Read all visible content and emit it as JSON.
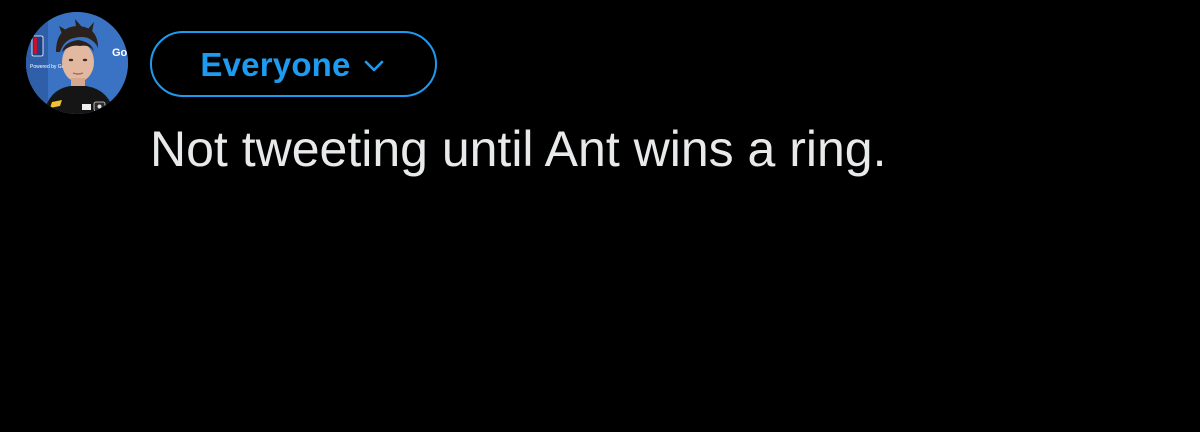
{
  "avatar": {
    "icon": "user-profile-photo",
    "badge_text": "Go",
    "caption_text": "Powered by Goo"
  },
  "audience": {
    "label": "Everyone",
    "icon": "chevron-down-icon",
    "accent_color": "#1d9bf0"
  },
  "composer": {
    "text": "Not tweeting until Ant wins a ring.",
    "text_color": "#e7e9ea",
    "background_color": "#000000"
  }
}
